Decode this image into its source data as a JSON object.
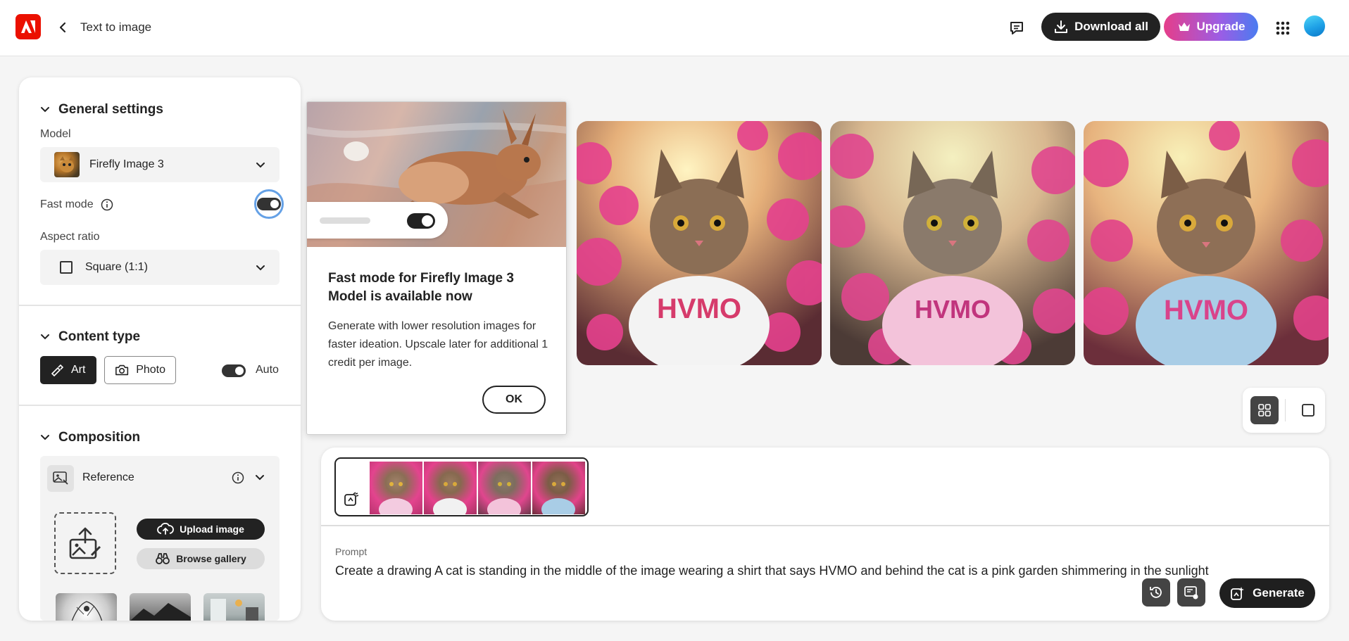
{
  "header": {
    "title": "Text to image",
    "download_all_label": "Download all",
    "upgrade_label": "Upgrade"
  },
  "left_panel": {
    "general_settings": {
      "heading": "General settings",
      "model_label": "Model",
      "model_value": "Firefly Image 3",
      "fast_mode_label": "Fast mode",
      "fast_mode_on": true,
      "aspect_ratio_label": "Aspect ratio",
      "aspect_ratio_value": "Square (1:1)"
    },
    "content_type": {
      "heading": "Content type",
      "options": [
        "Art",
        "Photo"
      ],
      "selected": "Art",
      "auto_label": "Auto",
      "auto_on": true
    },
    "composition": {
      "heading": "Composition",
      "reference_label": "Reference",
      "upload_label": "Upload image",
      "browse_label": "Browse gallery"
    }
  },
  "popover": {
    "title": "Fast mode for Firefly Image 3 Model is available now",
    "body": "Generate with lower resolution images for faster ideation. Upscale later for additional 1 credit per image.",
    "ok_label": "OK"
  },
  "results": {
    "shirt_texts": [
      "HVMO",
      "HVMO",
      "HVMO"
    ]
  },
  "prompt": {
    "label": "Prompt",
    "text": "Create a drawing A cat is standing in the middle of the image wearing a shirt that says HVMO and behind the cat is a pink garden shimmering in the sunlight",
    "generate_label": "Generate"
  },
  "colors": {
    "adobe_red": "#eb1000",
    "dark": "#222222",
    "focus_ring": "#4a90e2"
  }
}
